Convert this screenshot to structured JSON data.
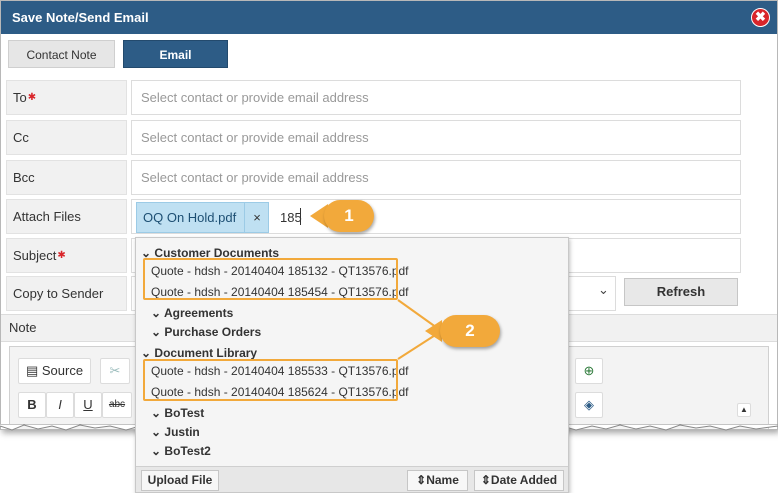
{
  "window": {
    "title": "Save Note/Send Email",
    "close_glyph": "✖"
  },
  "tabs": [
    {
      "label": "Contact Note",
      "active": false
    },
    {
      "label": "Email",
      "active": true
    }
  ],
  "form": {
    "to": {
      "label": "To",
      "required_mark": "✱",
      "placeholder": "Select contact or provide email address"
    },
    "cc": {
      "label": "Cc",
      "placeholder": "Select contact or provide email address"
    },
    "bcc": {
      "label": "Bcc",
      "placeholder": "Select contact or provide email address"
    },
    "attach": {
      "label": "Attach Files",
      "chip_name": "OQ On Hold.pdf",
      "chip_remove": "×",
      "typed_value": "185"
    },
    "subject": {
      "label": "Subject",
      "required_mark": "✱"
    },
    "copy_to_sender": {
      "label": "Copy to Sender"
    },
    "refresh_label": "Refresh",
    "note_label": "Note"
  },
  "editor_toolbar": {
    "source_label": "Source",
    "bold": "B",
    "italic": "I",
    "underline": "U",
    "strike": "abc"
  },
  "dropdown": {
    "groups": [
      {
        "label": "Customer Documents",
        "files": [
          "Quote - hdsh - 20140404 185132 - QT13576.pdf",
          "Quote - hdsh - 20140404 185454 - QT13576.pdf"
        ]
      },
      {
        "label": "Agreements"
      },
      {
        "label": "Purchase Orders"
      },
      {
        "label": "Document Library",
        "files": [
          "Quote - hdsh - 20140404 185533 - QT13576.pdf",
          "Quote - hdsh - 20140404 185624 - QT13576.pdf"
        ]
      },
      {
        "label": "BoTest"
      },
      {
        "label": "Justin"
      },
      {
        "label": "BoTest2"
      }
    ],
    "footer": {
      "upload_label": "Upload File",
      "sort_name_label": "Name",
      "sort_date_label": "Date Added"
    }
  },
  "callouts": [
    "1",
    "2"
  ],
  "colors": {
    "header": "#2d5c86",
    "accent_callout": "#f2a93b",
    "chip": "#bfe0f2",
    "required": "#d9252a"
  }
}
